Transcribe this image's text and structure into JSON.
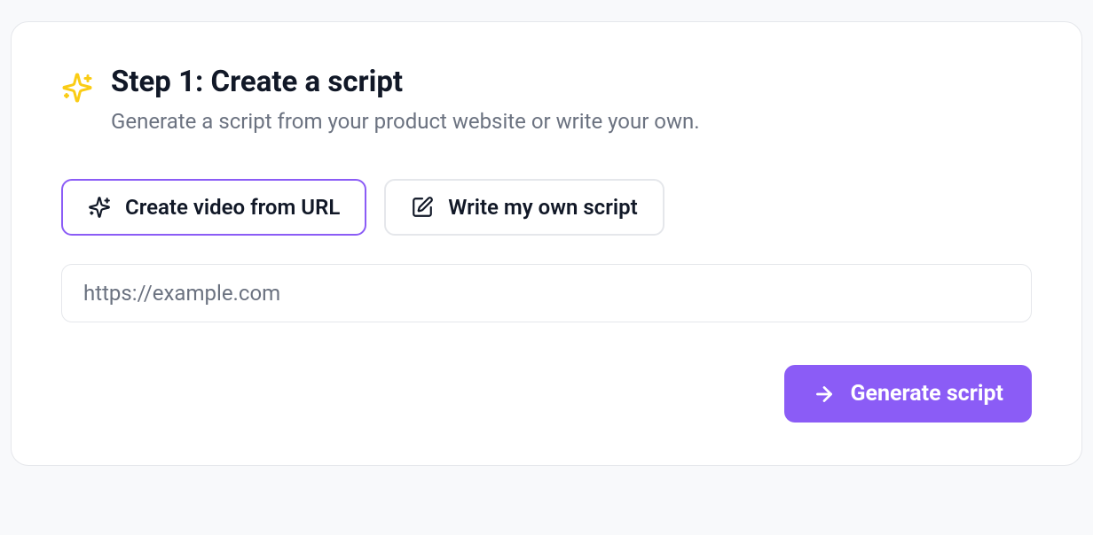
{
  "header": {
    "title": "Step 1: Create a script",
    "subtitle": "Generate a script from your product website or write your own."
  },
  "options": {
    "url": {
      "label": "Create video from URL"
    },
    "write": {
      "label": "Write my own script"
    }
  },
  "input": {
    "placeholder": "https://example.com",
    "value": ""
  },
  "action": {
    "generate_label": "Generate script"
  }
}
